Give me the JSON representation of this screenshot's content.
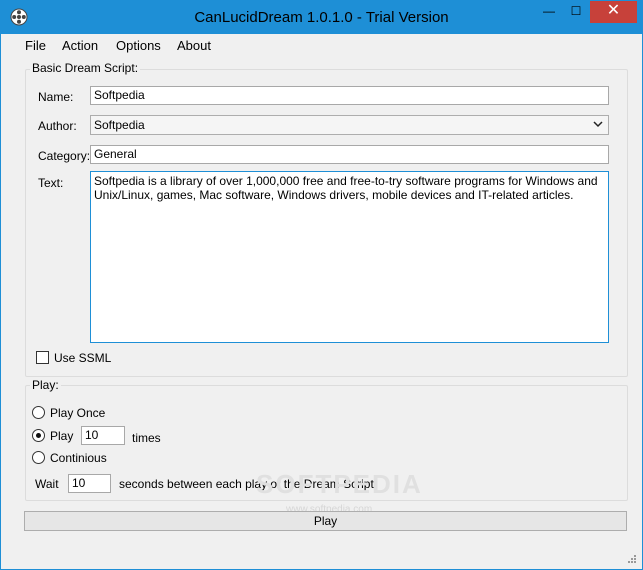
{
  "window": {
    "title": "CanLucidDream 1.0.1.0 - Trial Version",
    "accent": "#1e8fd6",
    "minimize_glyph": "—",
    "maximize_glyph": "☐",
    "close_glyph": "✕"
  },
  "menu": {
    "items": [
      {
        "label": "File"
      },
      {
        "label": "Action"
      },
      {
        "label": "Options"
      },
      {
        "label": "About"
      }
    ]
  },
  "script": {
    "legend": "Basic Dream Script:",
    "name_label": "Name:",
    "name_value": "Softpedia",
    "author_label": "Author:",
    "author_value": "Softpedia",
    "category_label": "Category:",
    "category_value": "General",
    "text_label": "Text:",
    "text_value": "Softpedia is a library of over 1,000,000 free and free-to-try software programs for Windows and Unix/Linux, games, Mac software, Windows drivers, mobile devices and IT-related articles.",
    "ssml_label": "Use SSML",
    "ssml_checked": false
  },
  "play": {
    "legend": "Play:",
    "once_label": "Play Once",
    "times_prefix": "Play",
    "times_value": "10",
    "times_suffix": "times",
    "continuous_label": "Continious",
    "selected": "times",
    "wait_label": "Wait",
    "wait_value": "10",
    "wait_suffix": "seconds between each play of the Dream Script.",
    "button_label": "Play"
  },
  "watermark": {
    "big": "SOFTPEDIA",
    "small": "www.softpedia.com"
  }
}
